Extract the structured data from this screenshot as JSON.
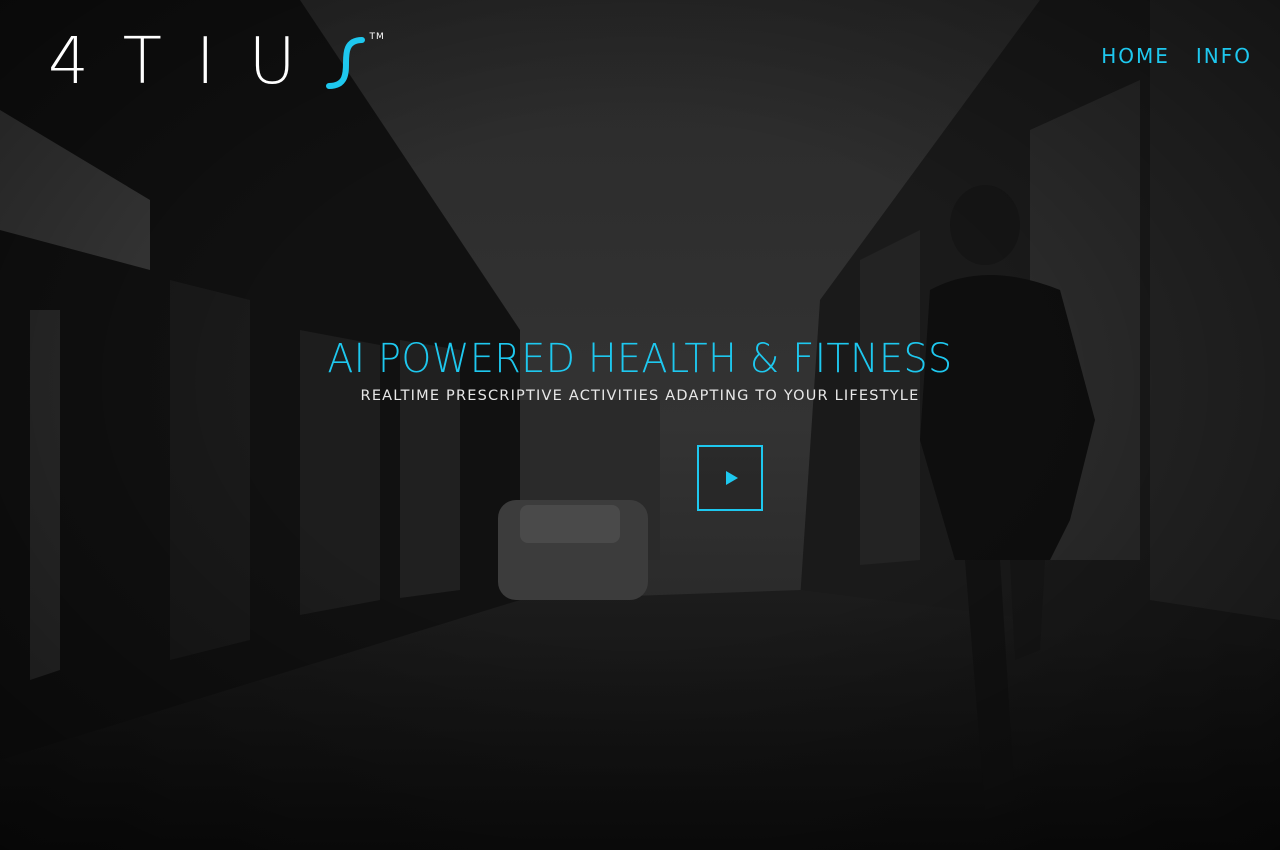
{
  "brand": {
    "logo_text": "4TIU",
    "logo_tm": "TM",
    "accent_color": "#1ec8ef"
  },
  "nav": {
    "items": [
      {
        "label": "HOME"
      },
      {
        "label": "INFO"
      }
    ]
  },
  "hero": {
    "headline": "AI POWERED HEALTH & FITNESS",
    "subheadline": "REALTIME PRESCRIPTIVE ACTIVITIES ADAPTING TO YOUR LIFESTYLE",
    "play_icon": "play-icon",
    "background": "dark street scene with woman running"
  }
}
